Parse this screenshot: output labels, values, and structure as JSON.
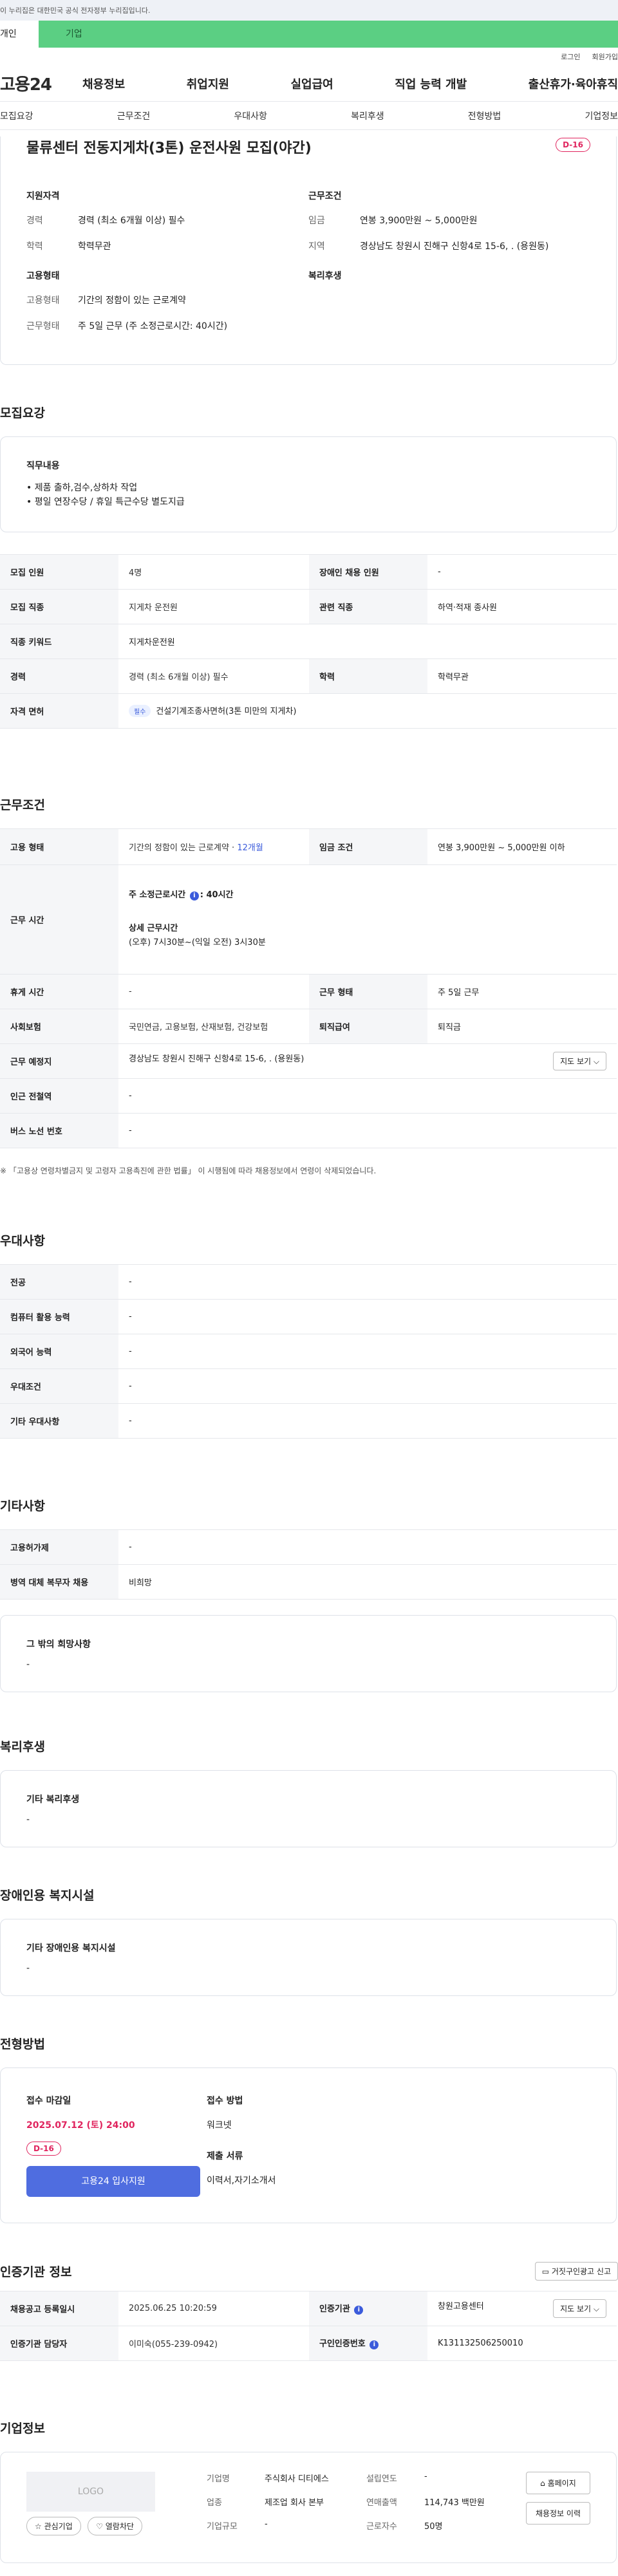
{
  "gov_bar": {
    "text": "이 누리집은 대한민국 공식 전자정부 누리집입니다."
  },
  "gnb_tabs": [
    {
      "label": "개인"
    },
    {
      "label": "기업"
    }
  ],
  "util": {
    "login": "로그인",
    "join": "회원가입"
  },
  "logo": "고용24",
  "nav": [
    "채용정보",
    "취업지원",
    "실업급여",
    "직업 능력 개발",
    "출산휴가·육아휴직"
  ],
  "subnav": [
    "모집요강",
    "근무조건",
    "우대사항",
    "복리후생",
    "전형방법",
    "기업정보"
  ],
  "summary": {
    "title": "물류센터 전동지게차(3톤) 운전사원 모집(야간)",
    "dday": "D-16",
    "left_head": "지원자격",
    "left_rows": [
      {
        "k": "경력",
        "v": "경력 (최소 6개월 이상) 필수"
      },
      {
        "k": "학력",
        "v": "학력무관"
      }
    ],
    "left_head2": "고용형태",
    "left_rows2": [
      {
        "k": "고용형태",
        "v": "기간의 정함이 있는 근로계약"
      },
      {
        "k": "근무형태",
        "v": "주 5일 근무 (주 소정근로시간: 40시간)"
      }
    ],
    "right_head": "근무조건",
    "right_rows": [
      {
        "k": "임금",
        "v": "연봉 3,900만원 ~ 5,000만원"
      },
      {
        "k": "지역",
        "v": "경상남도 창원시 진해구 신항4로 15-6, . (용원동)"
      }
    ],
    "right_head2": "복리후생"
  },
  "recruit": {
    "title": "모집요강",
    "box_head": "직무내용",
    "bullets": [
      "• 제품 출하,검수,상하차 작업",
      "• 평일 연장수당 / 휴일 특근수당 별도지급"
    ],
    "rows": [
      {
        "k1": "모집 인원",
        "v1": "4명",
        "k2": "장애인 채용 인원",
        "v2": "-"
      },
      {
        "k1": "모집 직종",
        "v1": "지게차 운전원",
        "k2": "관련 직종",
        "v2": "하역·적재 종사원"
      },
      {
        "k1": "직종 키워드",
        "v1": "지게차운전원"
      },
      {
        "k1": "경력",
        "v1": "경력 (최소 6개월 이상) 필수",
        "k2": "학력",
        "v2": "학력무관"
      }
    ],
    "license_k": "자격 면허",
    "license_chip": "필수",
    "license_v": "건설기계조종사면허(3톤 미만의 지게차)"
  },
  "conditions": {
    "title": "근무조건",
    "emp_k": "고용 형태",
    "emp_v": "기간의 정함이 있는 근로계약 · ",
    "emp_v2": "12개월",
    "wage_k": "임금 조건",
    "wage_v": "연봉 3,900만원 ~ 5,000만원 이하",
    "time_k": "근무 시간",
    "time_week": "주 소정근로시간",
    "time_week_v": ": 40시간",
    "time_detail_h": "상세 근무시간",
    "time_detail_v": "(오후) 7시30분~(익일 오전) 3시30분",
    "rest_k": "휴게 시간",
    "rest_v": "-",
    "shape_k": "근무 형태",
    "shape_v": "주 5일 근무",
    "ins_k": "사회보험",
    "ins_v": "국민연금, 고용보험, 산재보험, 건강보험",
    "ret_k": "퇴직급여",
    "ret_v": "퇴직금",
    "place_k": "근무 예정지",
    "place_v": "경상남도 창원시 진해구 신항4로 15-6, . (용원동)",
    "map_btn": "지도 보기 ⌵",
    "subway_k": "인근 전철역",
    "subway_v": "-",
    "bus_k": "버스 노선 번호",
    "bus_v": "-",
    "note": "※ 「고용상 연령차별금지 및 고령자 고용촉진에 관한 법률」 이 시행됨에 따라 채용정보에서 연령이 삭제되었습니다."
  },
  "pref": {
    "title": "우대사항",
    "rows": [
      {
        "k": "전공",
        "v": "-"
      },
      {
        "k": "컴퓨터 활용 능력",
        "v": "-"
      },
      {
        "k": "외국어 능력",
        "v": "-"
      },
      {
        "k": "우대조건",
        "v": "-"
      },
      {
        "k": "기타 우대사항",
        "v": "-"
      }
    ]
  },
  "etc": {
    "title": "기타사항",
    "rows": [
      {
        "k": "고용허가제",
        "v": "-"
      },
      {
        "k": "병역 대체 복무자 채용",
        "v": "비희망"
      }
    ],
    "box_head": "그 밖의 희망사항",
    "box_v": "-"
  },
  "welfare": {
    "title": "복리후생",
    "box_head": "기타 복리후생",
    "box_v": "-"
  },
  "disab": {
    "title": "장애인용 복지시설",
    "box_head": "기타 장애인용 복지시설",
    "box_v": "-"
  },
  "process": {
    "title": "전형방법",
    "deadline_lab": "접수 마감일",
    "deadline": "2025.07.12 (토) 24:00",
    "dday": "D-16",
    "apply_btn": "고용24 입사지원",
    "method_lab": "접수 방법",
    "method_v": "워크넷",
    "docs_lab": "제출 서류",
    "docs_v": "이력서,자기소개서"
  },
  "cert": {
    "title": "인증기관 정보",
    "report_btn": "거짓구인광고 신고",
    "reg_k": "채용공고 등록일시",
    "reg_v": "2025.06.25 10:20:59",
    "org_k": "인증기관",
    "org_v": "창원고용센터",
    "map_btn": "지도 보기 ⌵",
    "mgr_k": "인증기관 담당자",
    "mgr_v": "이미숙(055-239-0942)",
    "id_k": "구인인증번호",
    "id_v": "K131132506250010"
  },
  "company": {
    "title": "기업정보",
    "logo": "LOGO",
    "fav_btn": "☆ 관심기업",
    "view_btn": "♡ 열람차단",
    "name_k": "기업명",
    "name_v": "주식회사 디티에스",
    "ind_k": "업종",
    "ind_v": "제조업 회사 본부",
    "size_k": "기업규모",
    "size_v": "-",
    "year_k": "설립연도",
    "year_v": "-",
    "sales_k": "연매출액",
    "sales_v": "114,743 백만원",
    "emp_k": "근로자수",
    "emp_v": "50명",
    "home_btn": "홈페이지",
    "list_btn": "채용정보 이력"
  }
}
